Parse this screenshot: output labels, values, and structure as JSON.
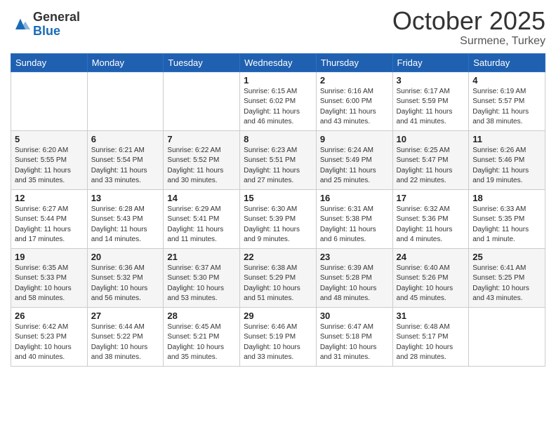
{
  "header": {
    "logo_general": "General",
    "logo_blue": "Blue",
    "month": "October 2025",
    "location": "Surmene, Turkey"
  },
  "weekdays": [
    "Sunday",
    "Monday",
    "Tuesday",
    "Wednesday",
    "Thursday",
    "Friday",
    "Saturday"
  ],
  "weeks": [
    [
      {
        "day": "",
        "info": ""
      },
      {
        "day": "",
        "info": ""
      },
      {
        "day": "",
        "info": ""
      },
      {
        "day": "1",
        "info": "Sunrise: 6:15 AM\nSunset: 6:02 PM\nDaylight: 11 hours\nand 46 minutes."
      },
      {
        "day": "2",
        "info": "Sunrise: 6:16 AM\nSunset: 6:00 PM\nDaylight: 11 hours\nand 43 minutes."
      },
      {
        "day": "3",
        "info": "Sunrise: 6:17 AM\nSunset: 5:59 PM\nDaylight: 11 hours\nand 41 minutes."
      },
      {
        "day": "4",
        "info": "Sunrise: 6:19 AM\nSunset: 5:57 PM\nDaylight: 11 hours\nand 38 minutes."
      }
    ],
    [
      {
        "day": "5",
        "info": "Sunrise: 6:20 AM\nSunset: 5:55 PM\nDaylight: 11 hours\nand 35 minutes."
      },
      {
        "day": "6",
        "info": "Sunrise: 6:21 AM\nSunset: 5:54 PM\nDaylight: 11 hours\nand 33 minutes."
      },
      {
        "day": "7",
        "info": "Sunrise: 6:22 AM\nSunset: 5:52 PM\nDaylight: 11 hours\nand 30 minutes."
      },
      {
        "day": "8",
        "info": "Sunrise: 6:23 AM\nSunset: 5:51 PM\nDaylight: 11 hours\nand 27 minutes."
      },
      {
        "day": "9",
        "info": "Sunrise: 6:24 AM\nSunset: 5:49 PM\nDaylight: 11 hours\nand 25 minutes."
      },
      {
        "day": "10",
        "info": "Sunrise: 6:25 AM\nSunset: 5:47 PM\nDaylight: 11 hours\nand 22 minutes."
      },
      {
        "day": "11",
        "info": "Sunrise: 6:26 AM\nSunset: 5:46 PM\nDaylight: 11 hours\nand 19 minutes."
      }
    ],
    [
      {
        "day": "12",
        "info": "Sunrise: 6:27 AM\nSunset: 5:44 PM\nDaylight: 11 hours\nand 17 minutes."
      },
      {
        "day": "13",
        "info": "Sunrise: 6:28 AM\nSunset: 5:43 PM\nDaylight: 11 hours\nand 14 minutes."
      },
      {
        "day": "14",
        "info": "Sunrise: 6:29 AM\nSunset: 5:41 PM\nDaylight: 11 hours\nand 11 minutes."
      },
      {
        "day": "15",
        "info": "Sunrise: 6:30 AM\nSunset: 5:39 PM\nDaylight: 11 hours\nand 9 minutes."
      },
      {
        "day": "16",
        "info": "Sunrise: 6:31 AM\nSunset: 5:38 PM\nDaylight: 11 hours\nand 6 minutes."
      },
      {
        "day": "17",
        "info": "Sunrise: 6:32 AM\nSunset: 5:36 PM\nDaylight: 11 hours\nand 4 minutes."
      },
      {
        "day": "18",
        "info": "Sunrise: 6:33 AM\nSunset: 5:35 PM\nDaylight: 11 hours\nand 1 minute."
      }
    ],
    [
      {
        "day": "19",
        "info": "Sunrise: 6:35 AM\nSunset: 5:33 PM\nDaylight: 10 hours\nand 58 minutes."
      },
      {
        "day": "20",
        "info": "Sunrise: 6:36 AM\nSunset: 5:32 PM\nDaylight: 10 hours\nand 56 minutes."
      },
      {
        "day": "21",
        "info": "Sunrise: 6:37 AM\nSunset: 5:30 PM\nDaylight: 10 hours\nand 53 minutes."
      },
      {
        "day": "22",
        "info": "Sunrise: 6:38 AM\nSunset: 5:29 PM\nDaylight: 10 hours\nand 51 minutes."
      },
      {
        "day": "23",
        "info": "Sunrise: 6:39 AM\nSunset: 5:28 PM\nDaylight: 10 hours\nand 48 minutes."
      },
      {
        "day": "24",
        "info": "Sunrise: 6:40 AM\nSunset: 5:26 PM\nDaylight: 10 hours\nand 45 minutes."
      },
      {
        "day": "25",
        "info": "Sunrise: 6:41 AM\nSunset: 5:25 PM\nDaylight: 10 hours\nand 43 minutes."
      }
    ],
    [
      {
        "day": "26",
        "info": "Sunrise: 6:42 AM\nSunset: 5:23 PM\nDaylight: 10 hours\nand 40 minutes."
      },
      {
        "day": "27",
        "info": "Sunrise: 6:44 AM\nSunset: 5:22 PM\nDaylight: 10 hours\nand 38 minutes."
      },
      {
        "day": "28",
        "info": "Sunrise: 6:45 AM\nSunset: 5:21 PM\nDaylight: 10 hours\nand 35 minutes."
      },
      {
        "day": "29",
        "info": "Sunrise: 6:46 AM\nSunset: 5:19 PM\nDaylight: 10 hours\nand 33 minutes."
      },
      {
        "day": "30",
        "info": "Sunrise: 6:47 AM\nSunset: 5:18 PM\nDaylight: 10 hours\nand 31 minutes."
      },
      {
        "day": "31",
        "info": "Sunrise: 6:48 AM\nSunset: 5:17 PM\nDaylight: 10 hours\nand 28 minutes."
      },
      {
        "day": "",
        "info": ""
      }
    ]
  ]
}
